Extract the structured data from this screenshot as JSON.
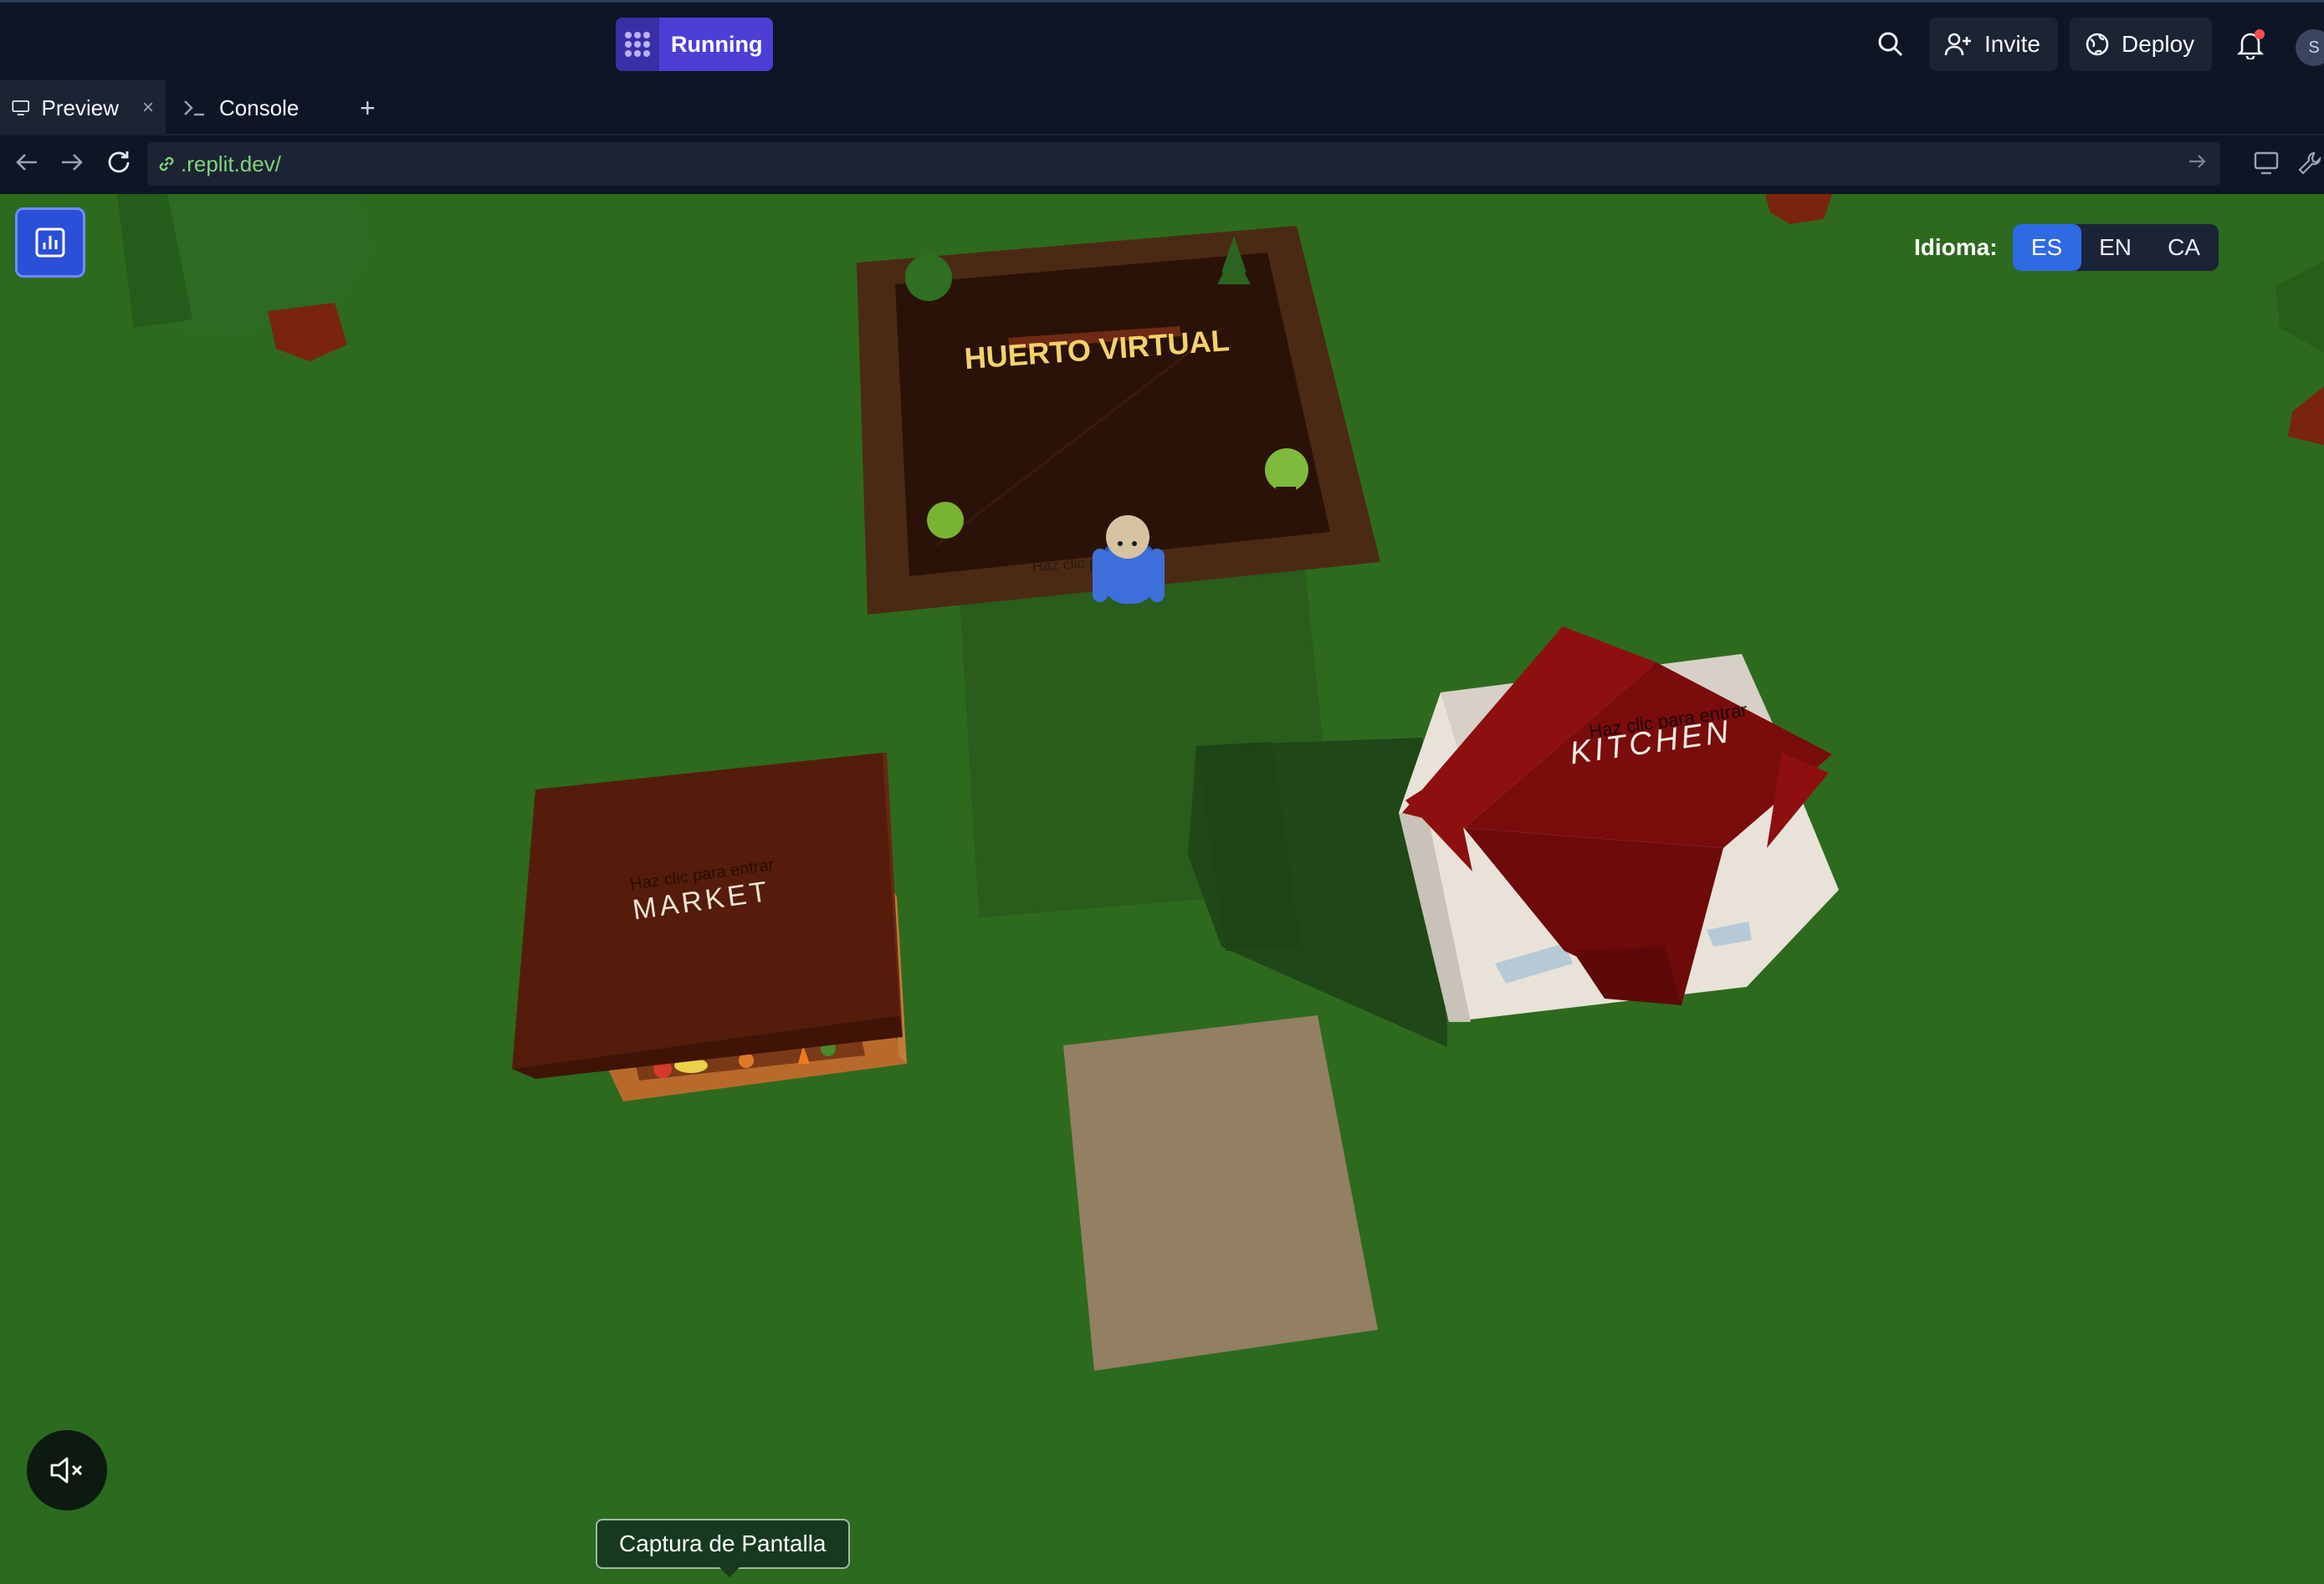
{
  "topbar": {
    "run_label": "Running",
    "invite_label": "Invite",
    "deploy_label": "Deploy",
    "avatar_letter": "S"
  },
  "tabs": [
    {
      "label": "Preview"
    },
    {
      "label": "Console"
    }
  ],
  "urlbar": {
    "url": ".replit.dev/"
  },
  "game": {
    "language_label": "Idioma:",
    "languages": [
      "ES",
      "EN",
      "CA"
    ],
    "selected_language": "ES",
    "buildings": {
      "garden_title": "HUERTO VIRTUAL",
      "garden_hint": "Haz clic para entrar",
      "market_title": "MARKET",
      "market_hint": "Haz clic para entrar",
      "kitchen_title": "KITCHEN",
      "kitchen_hint": "Haz clic para entrar"
    },
    "screenshot_tooltip": "Captura de Pantalla"
  },
  "colors": {
    "accent": "#2f6ae5",
    "running": "#4b3fd6",
    "grass": "#2f6a1d",
    "url_text": "#7fd47a"
  }
}
